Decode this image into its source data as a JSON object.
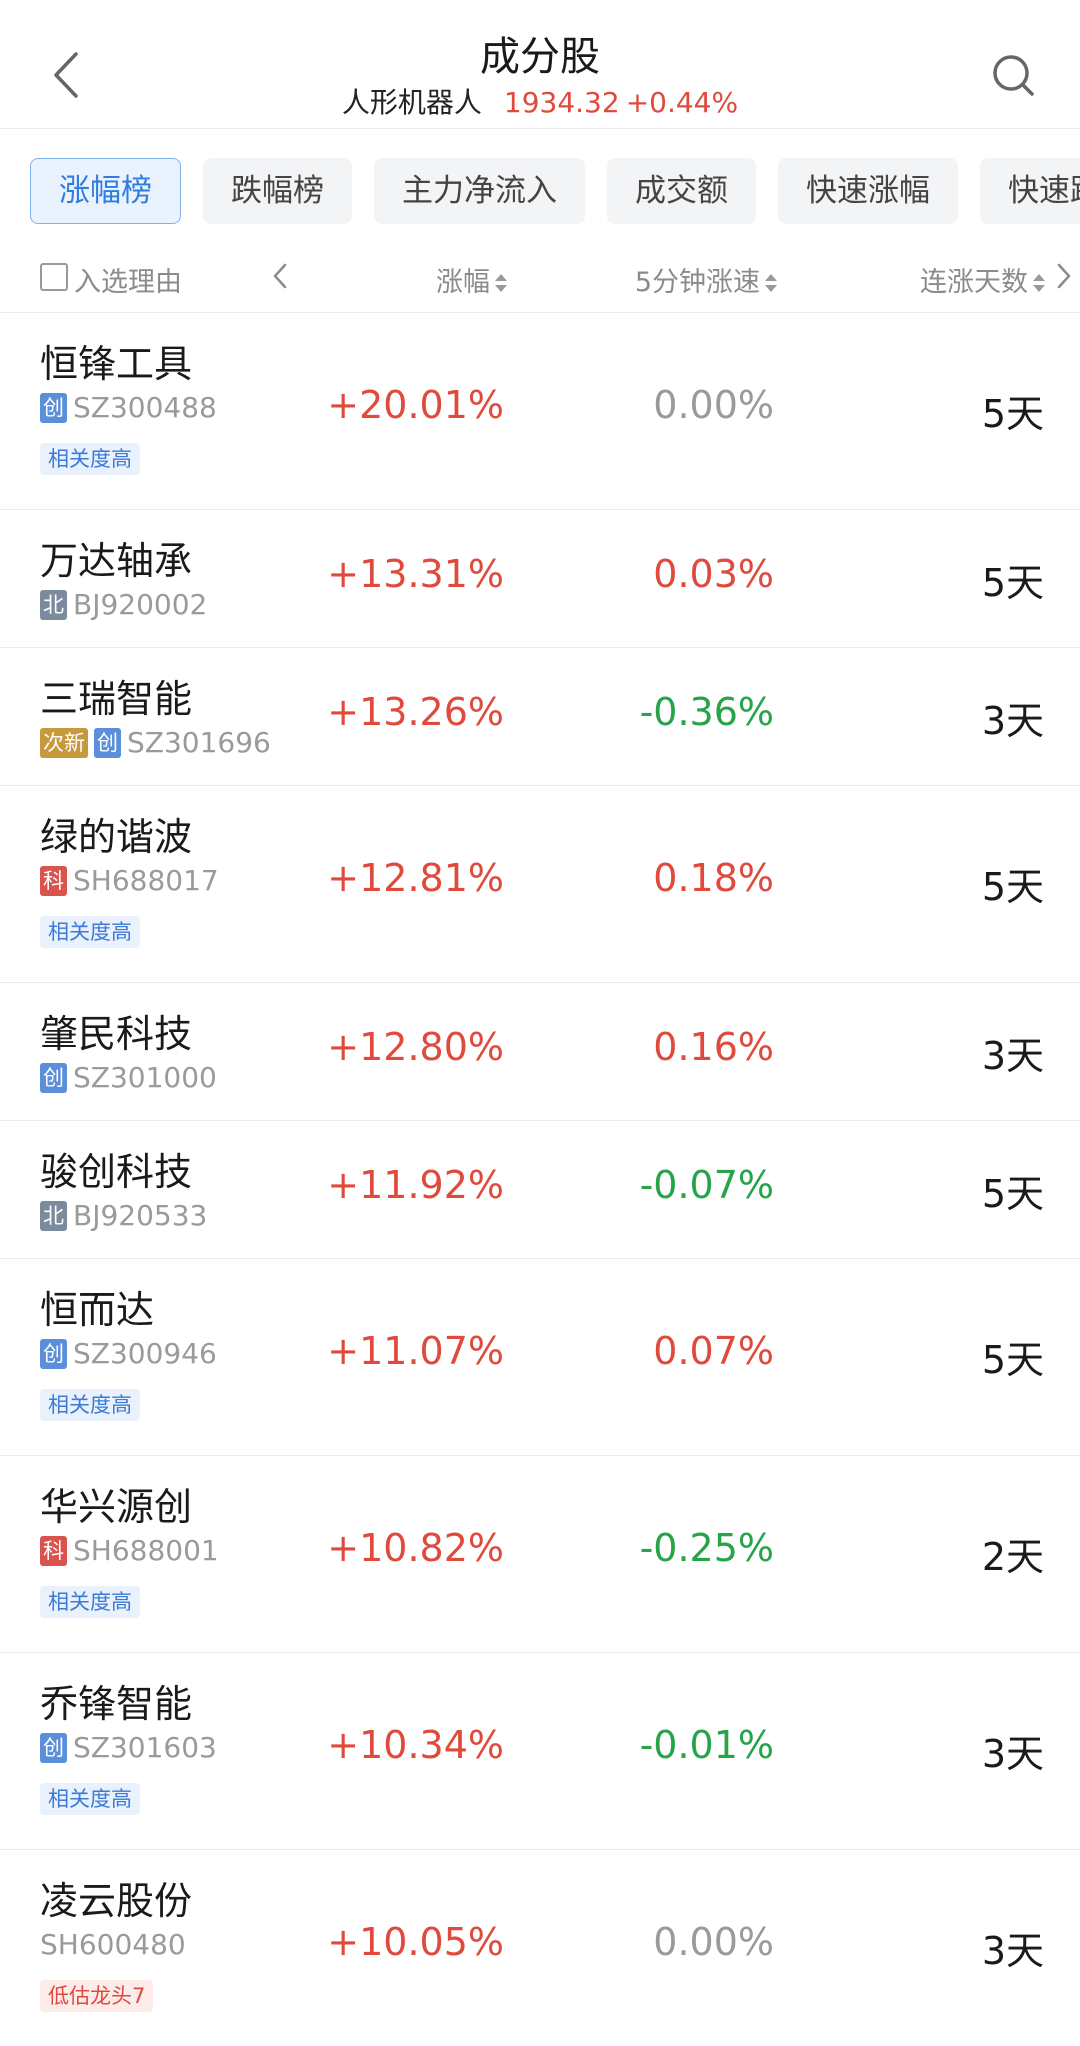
{
  "header": {
    "title": "成分股",
    "index_name": "人形机器人",
    "index_value": "1934.32",
    "index_change": "+0.44%"
  },
  "tabs": [
    {
      "label": "涨幅榜",
      "active": true
    },
    {
      "label": "跌幅榜",
      "active": false
    },
    {
      "label": "主力净流入",
      "active": false
    },
    {
      "label": "成交额",
      "active": false
    },
    {
      "label": "快速涨幅",
      "active": false
    },
    {
      "label": "快速跌幅",
      "active": false
    }
  ],
  "columns": {
    "reason": "入选理由",
    "change": "涨幅",
    "speed": "5分钟涨速",
    "days": "连涨天数"
  },
  "stocks": [
    {
      "name": "恒锋工具",
      "badges": [
        {
          "text": "创",
          "type": "cy"
        }
      ],
      "code": "SZ300488",
      "tag": "相关度高",
      "tag_type": "rel",
      "change": "+20.01%",
      "speed": "0.00%",
      "speed_dir": "flat",
      "days": "5天"
    },
    {
      "name": "万达轴承",
      "badges": [
        {
          "text": "北",
          "type": "bj"
        }
      ],
      "code": "BJ920002",
      "tag": "",
      "tag_type": "",
      "change": "+13.31%",
      "speed": "0.03%",
      "speed_dir": "up",
      "days": "5天"
    },
    {
      "name": "三瑞智能",
      "badges": [
        {
          "text": "次新",
          "type": "cx"
        },
        {
          "text": "创",
          "type": "cy"
        }
      ],
      "code": "SZ301696",
      "tag": "",
      "tag_type": "",
      "change": "+13.26%",
      "speed": "-0.36%",
      "speed_dir": "down",
      "days": "3天"
    },
    {
      "name": "绿的谐波",
      "badges": [
        {
          "text": "科",
          "type": "kc"
        }
      ],
      "code": "SH688017",
      "tag": "相关度高",
      "tag_type": "rel",
      "change": "+12.81%",
      "speed": "0.18%",
      "speed_dir": "up",
      "days": "5天"
    },
    {
      "name": "肇民科技",
      "badges": [
        {
          "text": "创",
          "type": "cy"
        }
      ],
      "code": "SZ301000",
      "tag": "",
      "tag_type": "",
      "change": "+12.80%",
      "speed": "0.16%",
      "speed_dir": "up",
      "days": "3天"
    },
    {
      "name": "骏创科技",
      "badges": [
        {
          "text": "北",
          "type": "bj"
        }
      ],
      "code": "BJ920533",
      "tag": "",
      "tag_type": "",
      "change": "+11.92%",
      "speed": "-0.07%",
      "speed_dir": "down",
      "days": "5天"
    },
    {
      "name": "恒而达",
      "badges": [
        {
          "text": "创",
          "type": "cy"
        }
      ],
      "code": "SZ300946",
      "tag": "相关度高",
      "tag_type": "rel",
      "change": "+11.07%",
      "speed": "0.07%",
      "speed_dir": "up",
      "days": "5天"
    },
    {
      "name": "华兴源创",
      "badges": [
        {
          "text": "科",
          "type": "kc"
        }
      ],
      "code": "SH688001",
      "tag": "相关度高",
      "tag_type": "rel",
      "change": "+10.82%",
      "speed": "-0.25%",
      "speed_dir": "down",
      "days": "2天"
    },
    {
      "name": "乔锋智能",
      "badges": [
        {
          "text": "创",
          "type": "cy"
        }
      ],
      "code": "SZ301603",
      "tag": "相关度高",
      "tag_type": "rel",
      "change": "+10.34%",
      "speed": "-0.01%",
      "speed_dir": "down",
      "days": "3天"
    },
    {
      "name": "凌云股份",
      "badges": [],
      "code": "SH600480",
      "tag": "低估龙头7",
      "tag_type": "low",
      "change": "+10.05%",
      "speed": "0.00%",
      "speed_dir": "flat",
      "days": "3天"
    }
  ]
}
